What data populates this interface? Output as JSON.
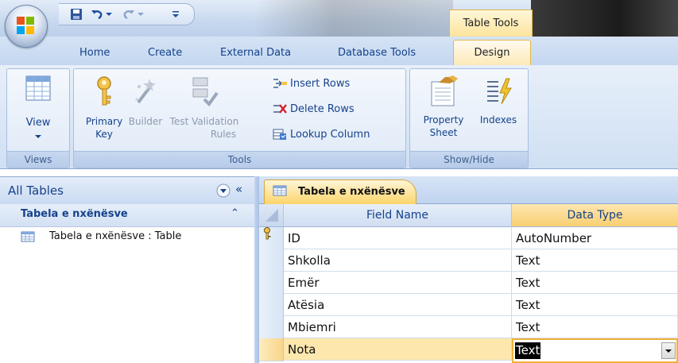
{
  "title_bar": {
    "contextual_tab": "Table Tools"
  },
  "tabs": [
    {
      "label": "Home"
    },
    {
      "label": "Create"
    },
    {
      "label": "External Data"
    },
    {
      "label": "Database Tools"
    },
    {
      "label": "Design"
    }
  ],
  "ribbon": {
    "views": {
      "label": "Views",
      "view_button": "View"
    },
    "tools": {
      "label": "Tools",
      "primary_key": [
        "Primary",
        "Key"
      ],
      "builder": "Builder",
      "test_validation": [
        "Test Validation",
        "Rules"
      ],
      "insert_rows": "Insert Rows",
      "delete_rows": "Delete Rows",
      "lookup_column": "Lookup Column"
    },
    "show_hide": {
      "label": "Show/Hide",
      "property_sheet": [
        "Property",
        "Sheet"
      ],
      "indexes": "Indexes"
    }
  },
  "navigation": {
    "header": "All Tables",
    "group": "Tabela e nxënësve",
    "item": "Tabela e nxënësve : Table"
  },
  "document": {
    "tab": "Tabela e nxënësve",
    "columns": [
      "Field Name",
      "Data Type"
    ],
    "rows": [
      {
        "field": "ID",
        "type": "AutoNumber",
        "primary_key": true
      },
      {
        "field": "Shkolla",
        "type": "Text"
      },
      {
        "field": "Emër",
        "type": "Text"
      },
      {
        "field": "Atësia",
        "type": "Text"
      },
      {
        "field": "Mbiemri",
        "type": "Text"
      },
      {
        "field": "Nota",
        "type": "Text",
        "selected": true
      }
    ]
  },
  "colors": {
    "accent_blue": "#15428b",
    "design_tab": "#fde9b4",
    "selected_row": "#fde7ad"
  }
}
